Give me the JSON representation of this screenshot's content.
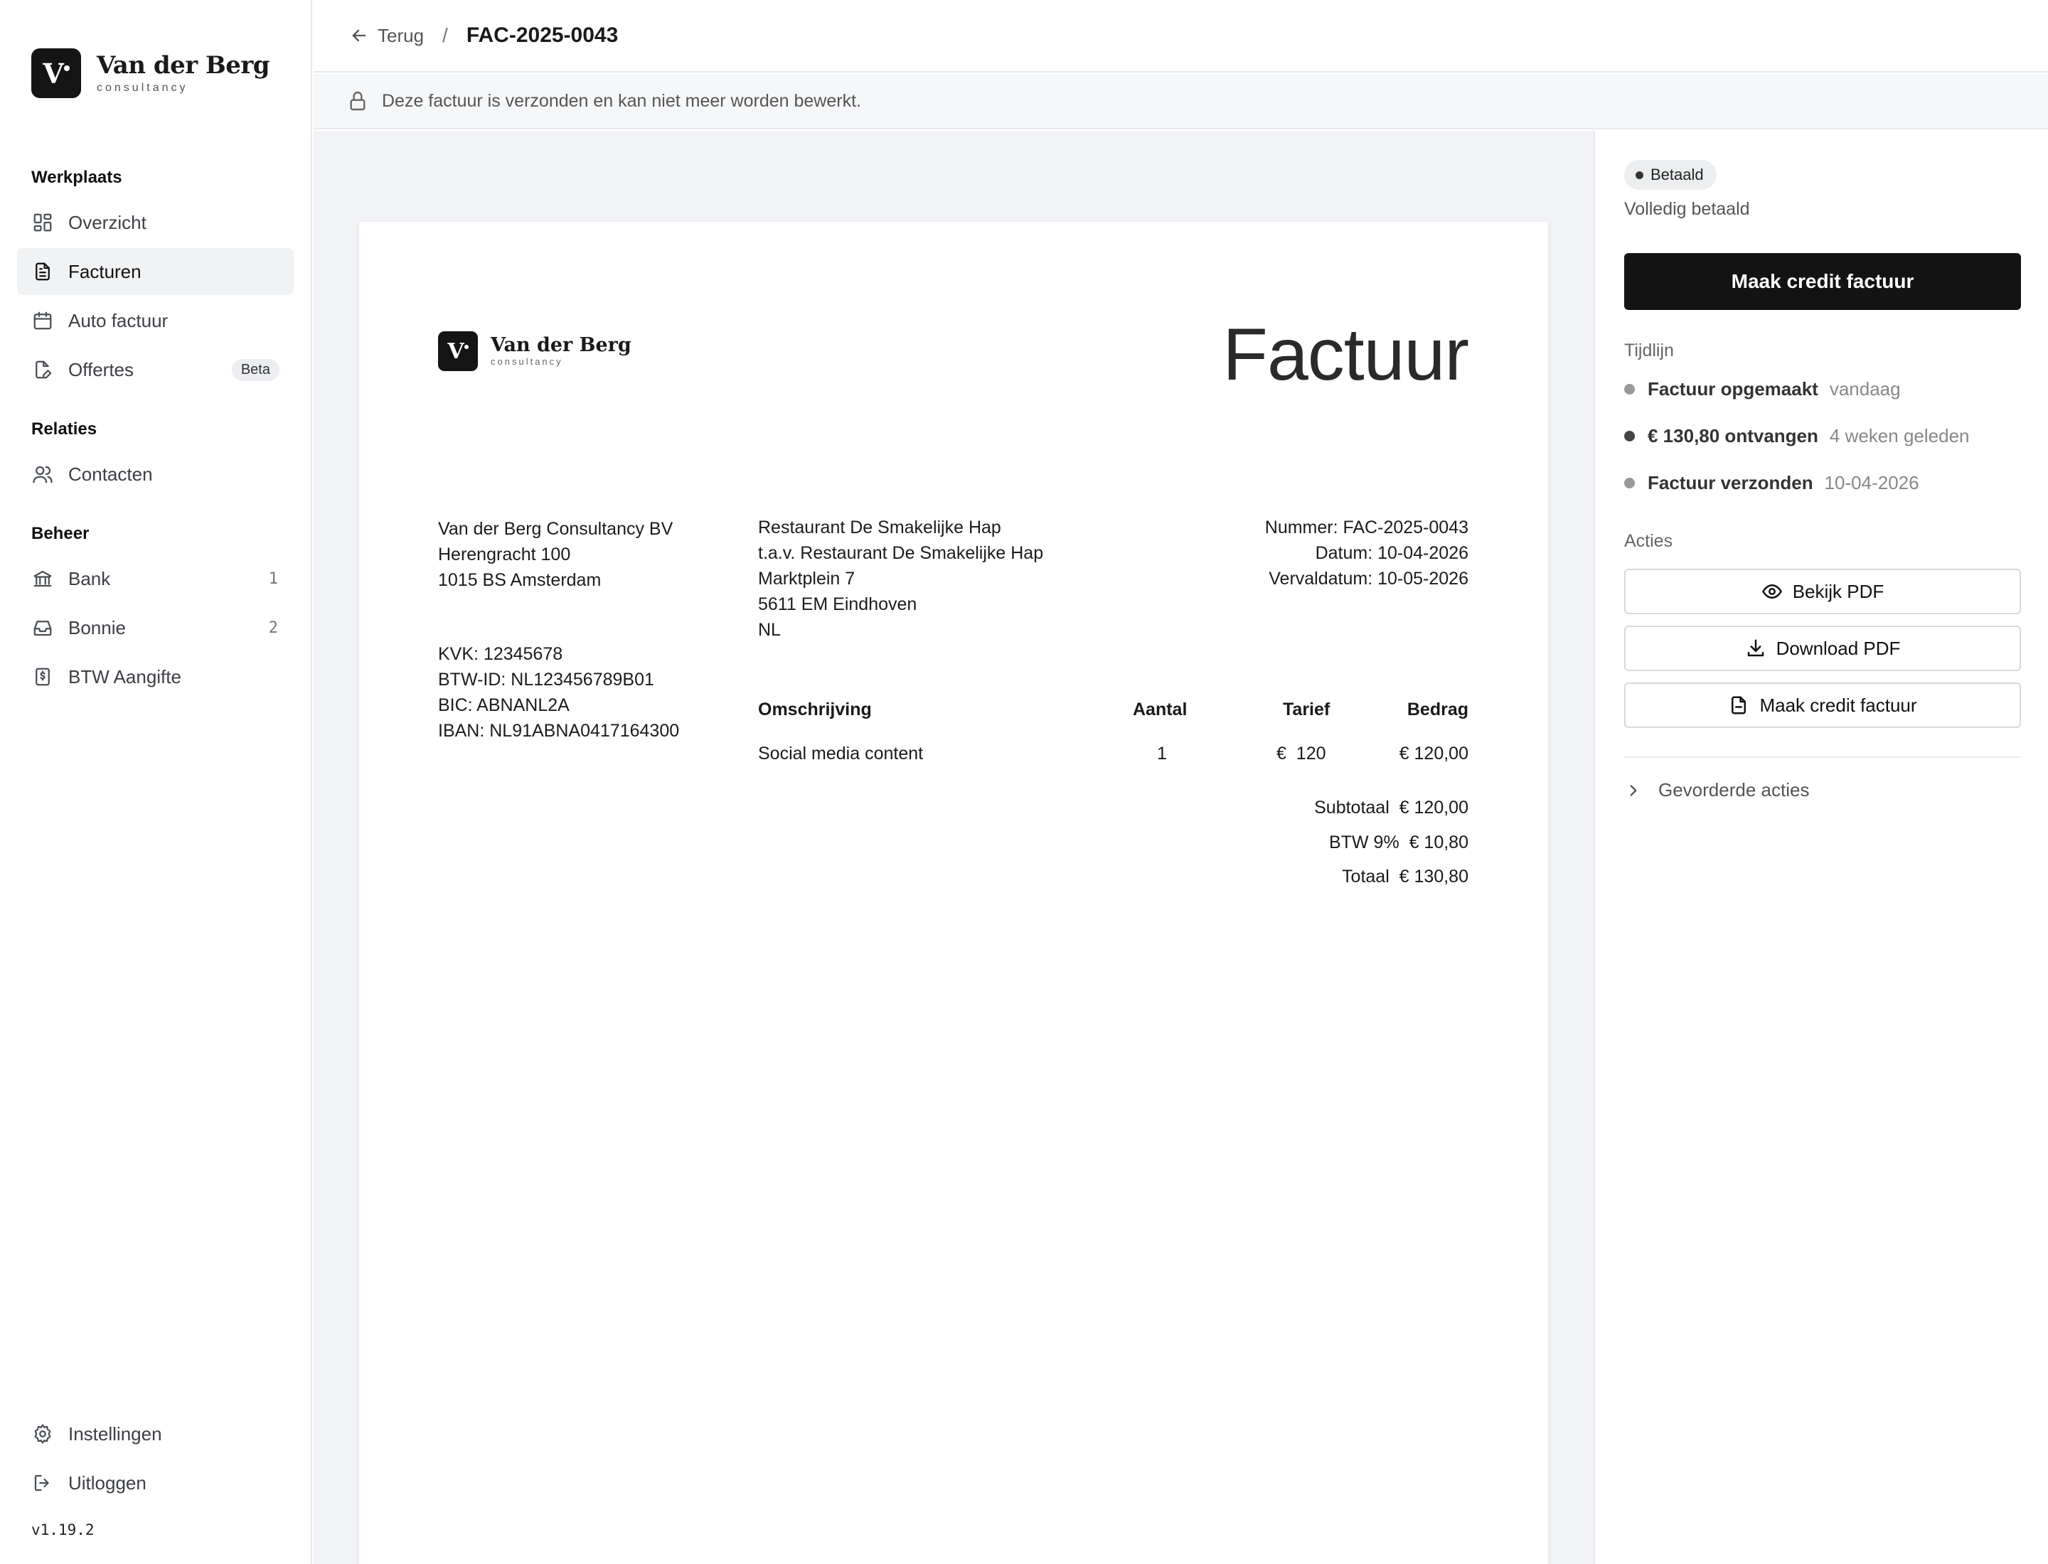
{
  "brand": {
    "name": "Van der Berg",
    "sub": "consultancy"
  },
  "sidebar": {
    "sections": [
      "Werkplaats",
      "Relaties",
      "Beheer"
    ],
    "items": [
      {
        "label": "Overzicht",
        "icon": "grid-icon"
      },
      {
        "label": "Facturen",
        "icon": "document-icon",
        "active": true
      },
      {
        "label": "Auto factuur",
        "icon": "calendar-icon"
      },
      {
        "label": "Offertes",
        "icon": "edit-document-icon",
        "badge": "Beta"
      },
      {
        "label": "Contacten",
        "icon": "users-icon"
      },
      {
        "label": "Bank",
        "icon": "bank-icon",
        "count": "1"
      },
      {
        "label": "Bonnie",
        "icon": "inbox-icon",
        "count": "2"
      },
      {
        "label": "BTW Aangifte",
        "icon": "tax-receipt-icon"
      }
    ],
    "footer": [
      {
        "label": "Instellingen",
        "icon": "gear-icon"
      },
      {
        "label": "Uitloggen",
        "icon": "logout-icon"
      }
    ],
    "version": "v1.19.2"
  },
  "topbar": {
    "back_label": "Terug",
    "separator": "/",
    "title": "FAC-2025-0043"
  },
  "notice": {
    "text": "Deze factuur is verzonden en kan niet meer worden bewerkt."
  },
  "invoice": {
    "logo_name": "Van der Berg",
    "logo_sub": "consultancy",
    "title": "Factuur",
    "sender": [
      "Van der Berg Consultancy BV",
      "Herengracht 100",
      "1015 BS Amsterdam"
    ],
    "sender_ids": [
      "KVK: 12345678",
      "BTW-ID: NL123456789B01",
      "BIC: ABNANL2A",
      "IBAN: NL91ABNA0417164300"
    ],
    "recipient": [
      "Restaurant De Smakelijke Hap",
      "t.a.v. Restaurant De Smakelijke Hap",
      "Marktplein 7",
      "5611 EM Eindhoven",
      "NL"
    ],
    "meta": [
      "Nummer: FAC-2025-0043",
      "Datum: 10-04-2026",
      "Vervaldatum: 10-05-2026"
    ],
    "table_headers": [
      "Omschrijving",
      "Aantal",
      "Tarief",
      "Bedrag"
    ],
    "rows": [
      {
        "description": "Social media content",
        "quantity": "1",
        "rate": "€  120",
        "amount": "€ 120,00"
      }
    ],
    "totals": [
      {
        "label": "Subtotaal",
        "value": "€ 120,00"
      },
      {
        "label": "BTW 9%",
        "value": "€ 10,80"
      },
      {
        "label": "Totaal",
        "value": "€ 130,80"
      }
    ]
  },
  "panel": {
    "status": "Betaald",
    "status_sub": "Volledig betaald",
    "primary_action": "Maak credit factuur",
    "timeline_label": "Tijdlijn",
    "timeline": [
      {
        "event": "Factuur opgemaakt",
        "time": "vandaag"
      },
      {
        "event": "€ 130,80 ontvangen",
        "time": "4 weken geleden"
      },
      {
        "event": "Factuur verzonden",
        "time": "10-04-2026"
      }
    ],
    "actions_label": "Acties",
    "actions": [
      {
        "label": "Bekijk PDF",
        "icon": "eye-icon"
      },
      {
        "label": "Download PDF",
        "icon": "download-icon"
      },
      {
        "label": "Maak credit factuur",
        "icon": "document-icon"
      }
    ],
    "advanced": "Gevorderde acties"
  }
}
